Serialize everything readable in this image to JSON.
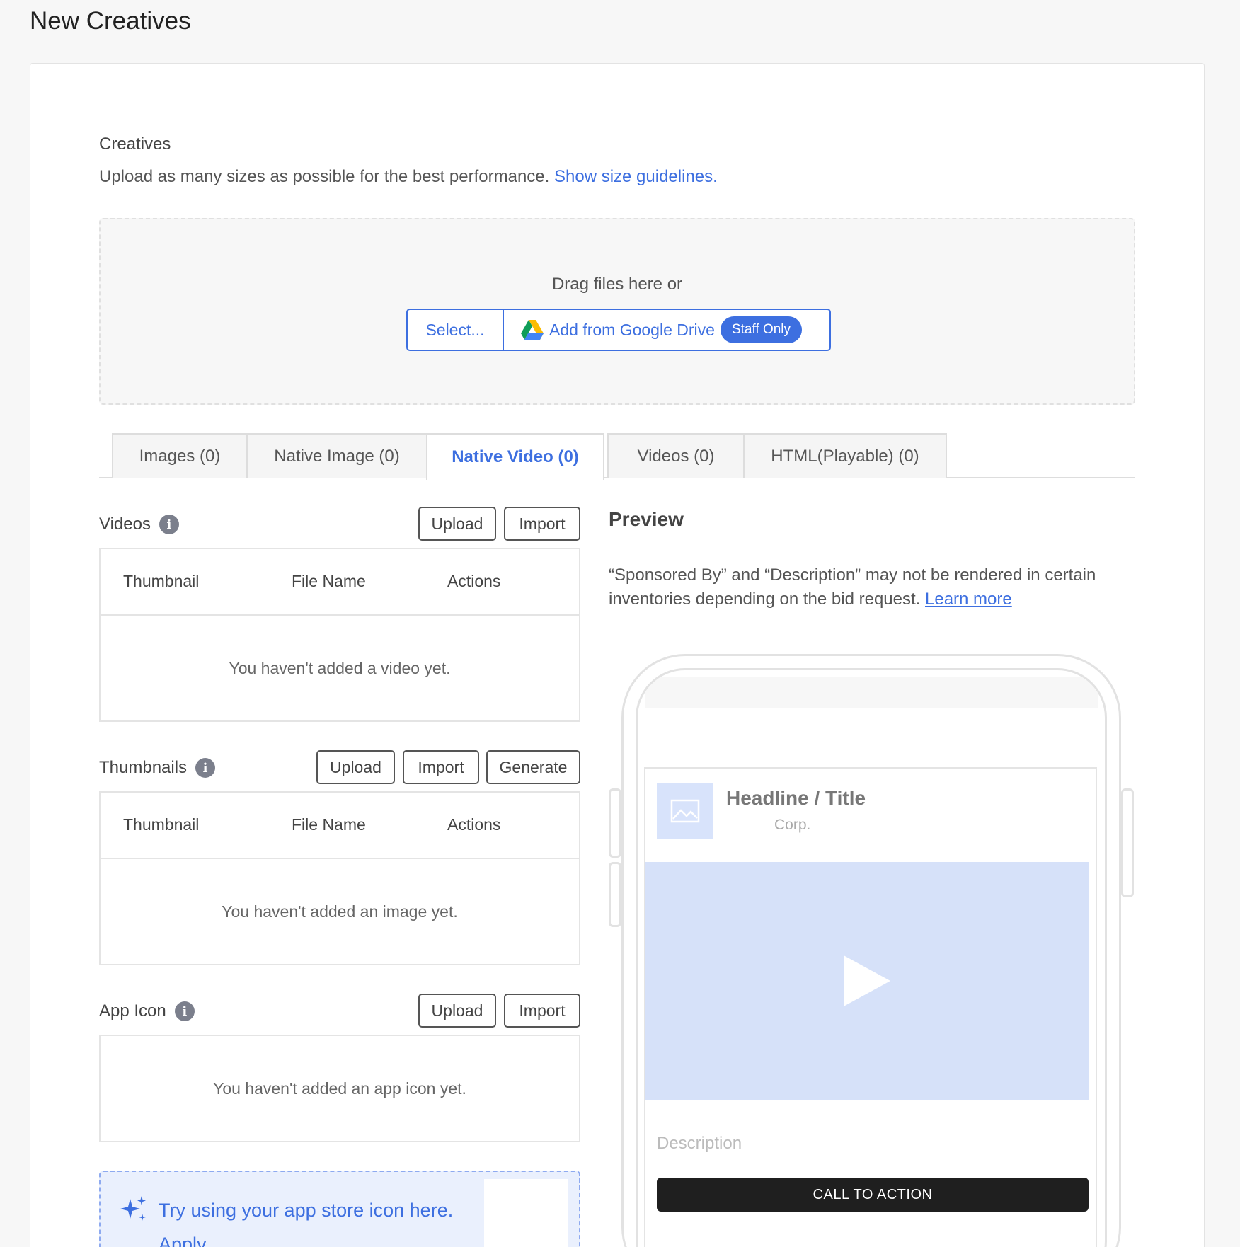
{
  "page": {
    "title": "New Creatives"
  },
  "creatives": {
    "title": "Creatives",
    "subtitle": "Upload as many sizes as possible for the best performance.",
    "guidelines_link": "Show size guidelines."
  },
  "dropzone": {
    "drag_text": "Drag files here or",
    "select_label": "Select...",
    "drive_label": "Add from Google Drive",
    "staff_badge": "Staff Only"
  },
  "tabs": [
    {
      "label": "Images (0)"
    },
    {
      "label": "Native Image (0)"
    },
    {
      "label": "Native Video (0)",
      "active": true
    },
    {
      "label": "Videos (0)"
    },
    {
      "label": "HTML(Playable) (0)"
    }
  ],
  "videos": {
    "title": "Videos",
    "upload_label": "Upload",
    "import_label": "Import",
    "columns": [
      "Thumbnail",
      "File Name",
      "Actions"
    ],
    "empty": "You haven't added a video yet."
  },
  "thumbnails": {
    "title": "Thumbnails",
    "upload_label": "Upload",
    "import_label": "Import",
    "generate_label": "Generate",
    "columns": [
      "Thumbnail",
      "File Name",
      "Actions"
    ],
    "empty": "You haven't added an image yet."
  },
  "app_icon": {
    "title": "App Icon",
    "upload_label": "Upload",
    "import_label": "Import",
    "empty": "You haven't added an app icon yet."
  },
  "hint": {
    "text": "Try using your app store icon here.",
    "apply_label": "Apply"
  },
  "preview": {
    "title": "Preview",
    "note": "“Sponsored By” and “Description” may not be rendered in certain inventories depending on the bid request.",
    "learn_more": "Learn more",
    "ad": {
      "headline": "Headline / Title",
      "sponsor": "Corp.",
      "description": "Description",
      "cta": "CALL TO ACTION"
    }
  },
  "colors": {
    "accent": "#3d6fe0",
    "placeholder_fill": "#d6e1f9",
    "cta_background": "#1f1f1f"
  },
  "icons": [
    "google-drive-icon",
    "info-icon",
    "sparkle-icon",
    "image-placeholder-icon",
    "play-icon"
  ]
}
